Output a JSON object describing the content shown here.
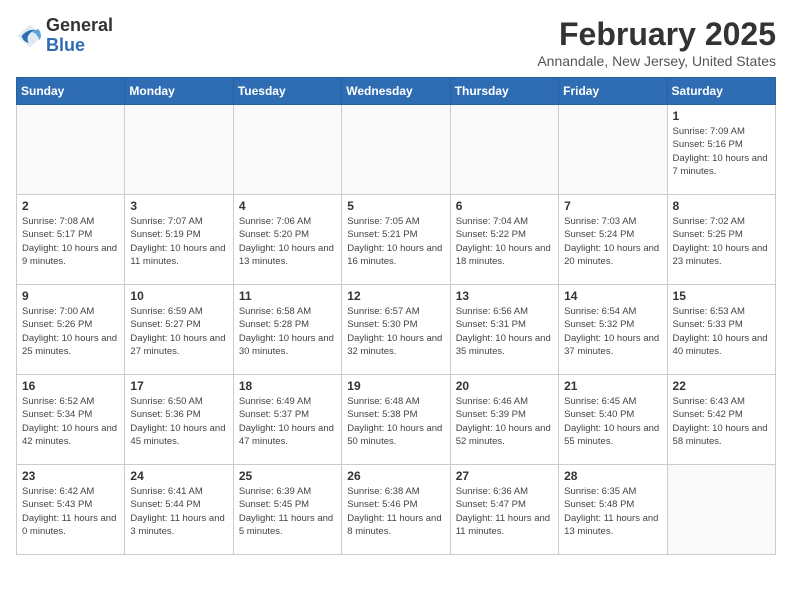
{
  "header": {
    "logo_general": "General",
    "logo_blue": "Blue",
    "month_title": "February 2025",
    "location": "Annandale, New Jersey, United States"
  },
  "weekdays": [
    "Sunday",
    "Monday",
    "Tuesday",
    "Wednesday",
    "Thursday",
    "Friday",
    "Saturday"
  ],
  "weeks": [
    [
      {
        "day": "",
        "info": ""
      },
      {
        "day": "",
        "info": ""
      },
      {
        "day": "",
        "info": ""
      },
      {
        "day": "",
        "info": ""
      },
      {
        "day": "",
        "info": ""
      },
      {
        "day": "",
        "info": ""
      },
      {
        "day": "1",
        "info": "Sunrise: 7:09 AM\nSunset: 5:16 PM\nDaylight: 10 hours\nand 7 minutes."
      }
    ],
    [
      {
        "day": "2",
        "info": "Sunrise: 7:08 AM\nSunset: 5:17 PM\nDaylight: 10 hours\nand 9 minutes."
      },
      {
        "day": "3",
        "info": "Sunrise: 7:07 AM\nSunset: 5:19 PM\nDaylight: 10 hours\nand 11 minutes."
      },
      {
        "day": "4",
        "info": "Sunrise: 7:06 AM\nSunset: 5:20 PM\nDaylight: 10 hours\nand 13 minutes."
      },
      {
        "day": "5",
        "info": "Sunrise: 7:05 AM\nSunset: 5:21 PM\nDaylight: 10 hours\nand 16 minutes."
      },
      {
        "day": "6",
        "info": "Sunrise: 7:04 AM\nSunset: 5:22 PM\nDaylight: 10 hours\nand 18 minutes."
      },
      {
        "day": "7",
        "info": "Sunrise: 7:03 AM\nSunset: 5:24 PM\nDaylight: 10 hours\nand 20 minutes."
      },
      {
        "day": "8",
        "info": "Sunrise: 7:02 AM\nSunset: 5:25 PM\nDaylight: 10 hours\nand 23 minutes."
      }
    ],
    [
      {
        "day": "9",
        "info": "Sunrise: 7:00 AM\nSunset: 5:26 PM\nDaylight: 10 hours\nand 25 minutes."
      },
      {
        "day": "10",
        "info": "Sunrise: 6:59 AM\nSunset: 5:27 PM\nDaylight: 10 hours\nand 27 minutes."
      },
      {
        "day": "11",
        "info": "Sunrise: 6:58 AM\nSunset: 5:28 PM\nDaylight: 10 hours\nand 30 minutes."
      },
      {
        "day": "12",
        "info": "Sunrise: 6:57 AM\nSunset: 5:30 PM\nDaylight: 10 hours\nand 32 minutes."
      },
      {
        "day": "13",
        "info": "Sunrise: 6:56 AM\nSunset: 5:31 PM\nDaylight: 10 hours\nand 35 minutes."
      },
      {
        "day": "14",
        "info": "Sunrise: 6:54 AM\nSunset: 5:32 PM\nDaylight: 10 hours\nand 37 minutes."
      },
      {
        "day": "15",
        "info": "Sunrise: 6:53 AM\nSunset: 5:33 PM\nDaylight: 10 hours\nand 40 minutes."
      }
    ],
    [
      {
        "day": "16",
        "info": "Sunrise: 6:52 AM\nSunset: 5:34 PM\nDaylight: 10 hours\nand 42 minutes."
      },
      {
        "day": "17",
        "info": "Sunrise: 6:50 AM\nSunset: 5:36 PM\nDaylight: 10 hours\nand 45 minutes."
      },
      {
        "day": "18",
        "info": "Sunrise: 6:49 AM\nSunset: 5:37 PM\nDaylight: 10 hours\nand 47 minutes."
      },
      {
        "day": "19",
        "info": "Sunrise: 6:48 AM\nSunset: 5:38 PM\nDaylight: 10 hours\nand 50 minutes."
      },
      {
        "day": "20",
        "info": "Sunrise: 6:46 AM\nSunset: 5:39 PM\nDaylight: 10 hours\nand 52 minutes."
      },
      {
        "day": "21",
        "info": "Sunrise: 6:45 AM\nSunset: 5:40 PM\nDaylight: 10 hours\nand 55 minutes."
      },
      {
        "day": "22",
        "info": "Sunrise: 6:43 AM\nSunset: 5:42 PM\nDaylight: 10 hours\nand 58 minutes."
      }
    ],
    [
      {
        "day": "23",
        "info": "Sunrise: 6:42 AM\nSunset: 5:43 PM\nDaylight: 11 hours\nand 0 minutes."
      },
      {
        "day": "24",
        "info": "Sunrise: 6:41 AM\nSunset: 5:44 PM\nDaylight: 11 hours\nand 3 minutes."
      },
      {
        "day": "25",
        "info": "Sunrise: 6:39 AM\nSunset: 5:45 PM\nDaylight: 11 hours\nand 5 minutes."
      },
      {
        "day": "26",
        "info": "Sunrise: 6:38 AM\nSunset: 5:46 PM\nDaylight: 11 hours\nand 8 minutes."
      },
      {
        "day": "27",
        "info": "Sunrise: 6:36 AM\nSunset: 5:47 PM\nDaylight: 11 hours\nand 11 minutes."
      },
      {
        "day": "28",
        "info": "Sunrise: 6:35 AM\nSunset: 5:48 PM\nDaylight: 11 hours\nand 13 minutes."
      },
      {
        "day": "",
        "info": ""
      }
    ]
  ]
}
